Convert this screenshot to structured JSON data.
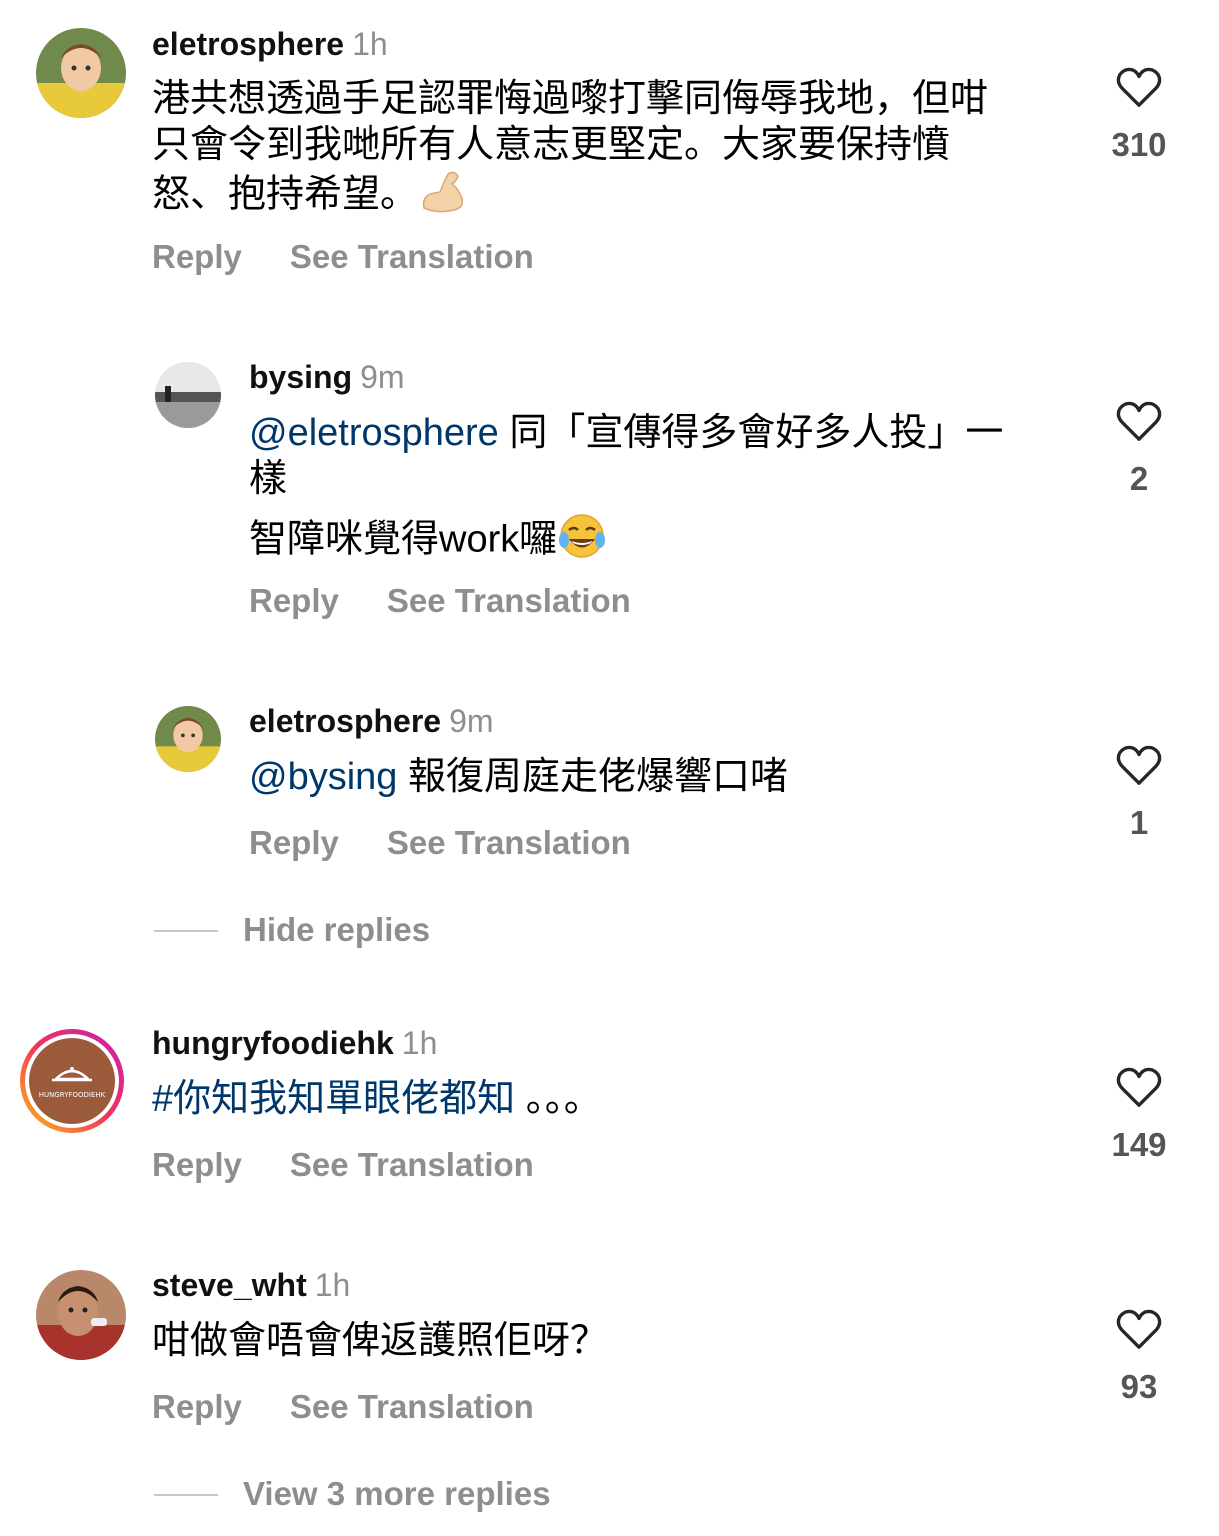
{
  "colors": {
    "username": "#111111",
    "meta": "#8e8e8e",
    "link": "#00376b",
    "divider": "#c7c7c7"
  },
  "icons": {
    "like": "heart-outline-icon",
    "flex": "flexed-biceps-emoji",
    "laugh": "tears-of-joy-emoji"
  },
  "comments": [
    {
      "username": "eletrosphere",
      "time": "1h",
      "line1": "港共想透過手足認罪悔過嚟打擊同侮辱我地，但咁",
      "line2": "只會令到我哋所有人意志更堅定。大家要保持憤",
      "line3": "怒、抱持希望。",
      "reply": "Reply",
      "translate": "See Translation",
      "likes": "310"
    },
    {
      "username": "bysing",
      "time": "9m",
      "mention": "@eletrosphere",
      "line1": " 同「宣傳得多會好多人投」一",
      "line2": "樣",
      "line3": "智障咪覺得work囉",
      "reply": "Reply",
      "translate": "See Translation",
      "likes": "2"
    },
    {
      "username": "eletrosphere",
      "time": "9m",
      "mention": "@bysing",
      "line1": " 報復周庭走佬爆響口啫",
      "reply": "Reply",
      "translate": "See Translation",
      "likes": "1"
    },
    {
      "username": "hungryfoodiehk",
      "time": "1h",
      "hashtag": "#你知我知單眼佬都知",
      "line1": " 。。。",
      "avatar_text": "HUNGRYFOODIEHK",
      "reply": "Reply",
      "translate": "See Translation",
      "likes": "149"
    },
    {
      "username": "steve_wht",
      "time": "1h",
      "line1": "咁做會唔會俾返護照佢呀？",
      "reply": "Reply",
      "translate": "See Translation",
      "likes": "93"
    }
  ],
  "threads": {
    "hide_replies": "Hide replies",
    "view_more": "View 3 more replies"
  }
}
